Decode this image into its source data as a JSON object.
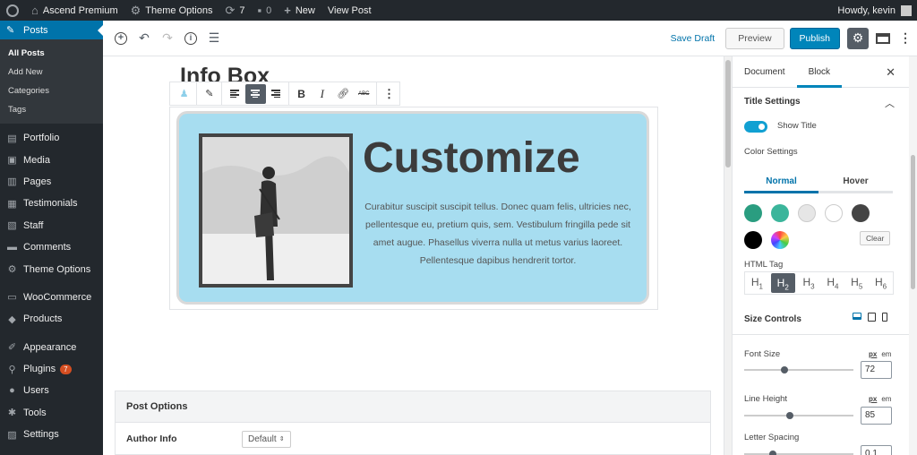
{
  "adminbar": {
    "site_name": "Ascend Premium",
    "theme_options": "Theme Options",
    "updates_count": "7",
    "comments_count": "0",
    "new_label": "New",
    "view_post": "View Post",
    "howdy": "Howdy, kevin"
  },
  "sidebar": {
    "posts": "Posts",
    "submenu": [
      "All Posts",
      "Add New",
      "Categories",
      "Tags"
    ],
    "items": [
      {
        "label": "Portfolio",
        "icon": "portfolio-icon"
      },
      {
        "label": "Media",
        "icon": "media-icon"
      },
      {
        "label": "Pages",
        "icon": "pages-icon"
      },
      {
        "label": "Testimonials",
        "icon": "testimonials-icon"
      },
      {
        "label": "Staff",
        "icon": "staff-icon"
      },
      {
        "label": "Comments",
        "icon": "comments-icon"
      },
      {
        "label": "Theme Options",
        "icon": "gear-icon"
      },
      {
        "label": "WooCommerce",
        "icon": "woocommerce-icon"
      },
      {
        "label": "Products",
        "icon": "products-icon"
      },
      {
        "label": "Appearance",
        "icon": "appearance-icon"
      },
      {
        "label": "Plugins",
        "icon": "plugins-icon",
        "badge": "7"
      },
      {
        "label": "Users",
        "icon": "users-icon"
      },
      {
        "label": "Tools",
        "icon": "tools-icon"
      },
      {
        "label": "Settings",
        "icon": "settings-icon"
      }
    ]
  },
  "toolbar": {
    "save_draft": "Save Draft",
    "preview": "Preview",
    "publish": "Publish"
  },
  "editor": {
    "post_title": "Info Box",
    "block_toolbar": {
      "strike_label": "ABC"
    },
    "infobox": {
      "heading": "Customize",
      "body": "Curabitur suscipit suscipit tellus. Donec quam felis, ultricies nec, pellentesque eu, pretium quis, sem. Vestibulum fringilla pede sit amet augue. Phasellus viverra nulla ut metus varius laoreet. Pellentesque dapibus hendrerit tortor.",
      "background_color": "#a7ddf0"
    },
    "post_options": {
      "title": "Post Options",
      "author_info_label": "Author Info",
      "author_info_value": "Default"
    }
  },
  "panel": {
    "tabs": [
      "Document",
      "Block"
    ],
    "active_tab": "Block",
    "title_settings": "Title Settings",
    "show_title": "Show Title",
    "color_settings": "Color Settings",
    "color_tabs": [
      "Normal",
      "Hover"
    ],
    "swatches": [
      "#2a9d80",
      "#3bb59b",
      "#e6e6e6",
      "#ffffff",
      "#444444",
      "#000000"
    ],
    "clear": "Clear",
    "html_tag": "HTML Tag",
    "html_tags": [
      {
        "h": "H",
        "n": "1"
      },
      {
        "h": "H",
        "n": "2"
      },
      {
        "h": "H",
        "n": "3"
      },
      {
        "h": "H",
        "n": "4"
      },
      {
        "h": "H",
        "n": "5"
      },
      {
        "h": "H",
        "n": "6"
      }
    ],
    "size_controls": "Size Controls",
    "font_size_label": "Font Size",
    "font_size_value": "72",
    "line_height_label": "Line Height",
    "line_height_value": "85",
    "letter_spacing_label": "Letter Spacing",
    "letter_spacing_value": "0.1",
    "unit_px": "px",
    "unit_em": "em"
  }
}
